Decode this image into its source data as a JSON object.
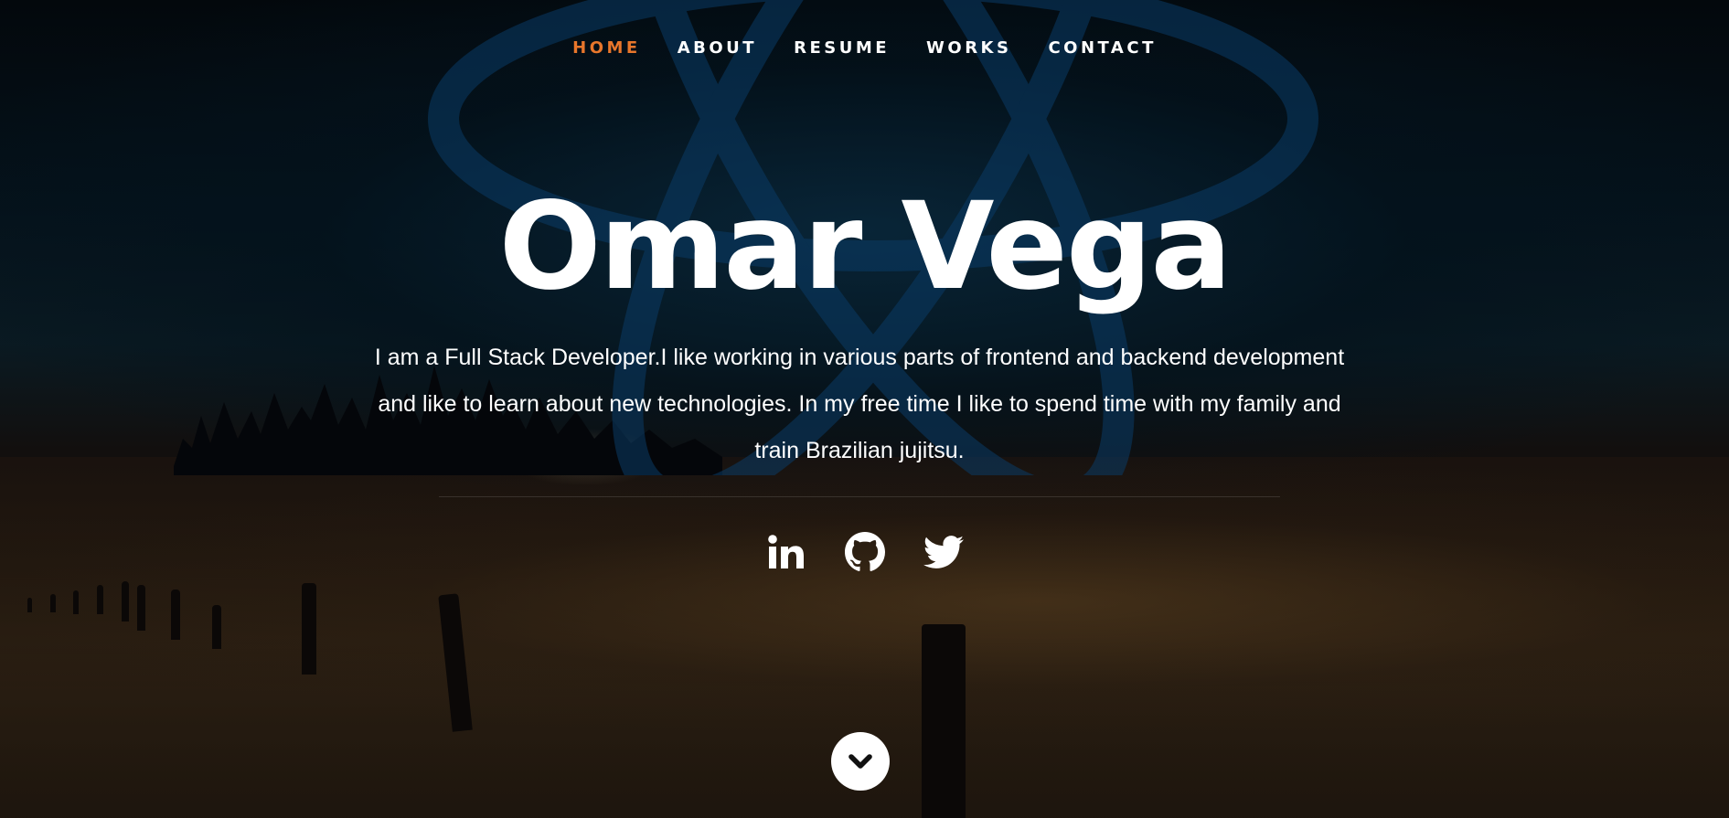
{
  "nav": {
    "items": [
      {
        "label": "HOME",
        "active": true
      },
      {
        "label": "ABOUT",
        "active": false
      },
      {
        "label": "RESUME",
        "active": false
      },
      {
        "label": "WORKS",
        "active": false
      },
      {
        "label": "CONTACT",
        "active": false
      }
    ],
    "active_color": "#e8762b",
    "text_color": "#ffffff"
  },
  "hero": {
    "name": "Omar Vega",
    "bio": "I am a Full Stack Developer.I like working in various parts of frontend and backend development and like to learn about new technologies. In my free time I like to spend time with my family and train Brazilian jujitsu."
  },
  "socials": [
    {
      "icon": "linkedin-icon"
    },
    {
      "icon": "github-icon"
    },
    {
      "icon": "twitter-icon"
    }
  ],
  "scroll_button": {
    "icon": "chevron-down-icon"
  },
  "background": {
    "icon": "react-logo-icon"
  }
}
